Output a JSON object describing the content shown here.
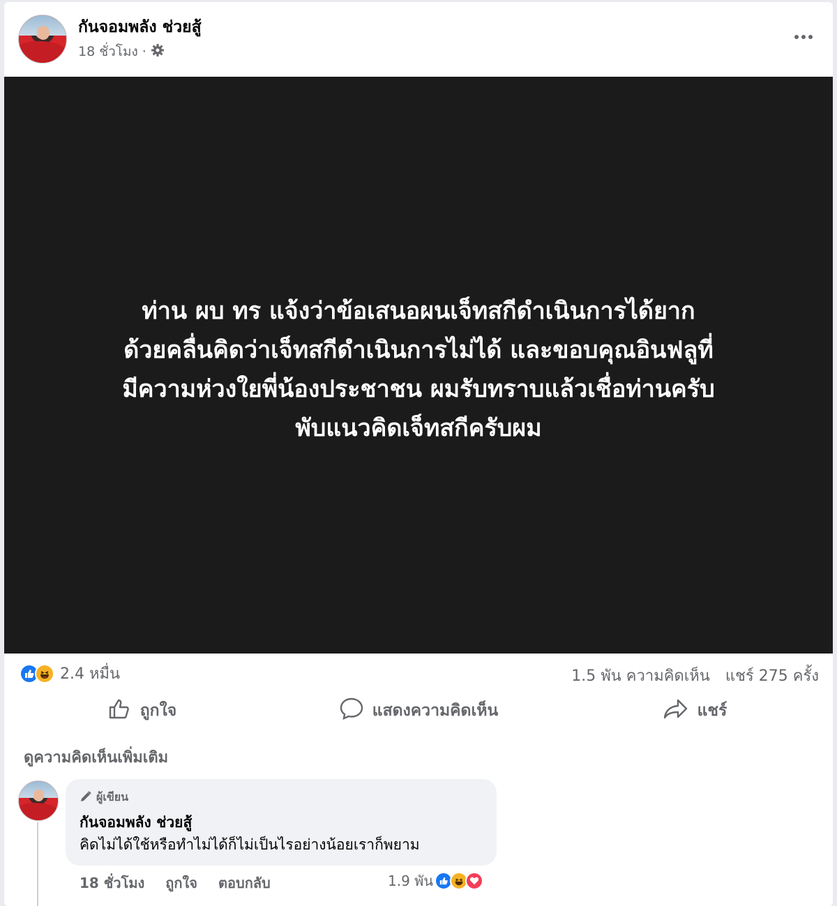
{
  "post": {
    "author": "กันจอมพลัง ช่วยสู้",
    "time": "18 ชั่วโมง",
    "separator": "·",
    "privacy_icon": "gear-icon",
    "more_icon": "more-horizontal-icon",
    "text_lines": [
      "ท่าน ผบ ทร แจ้งว่าข้อเสนอผนเจ็ทสกีดำเนินการได้ยาก",
      "ด้วยคลื่นคิดว่าเจ็ทสกีดำเนินการไม่ได้ และขอบคุณอินฟลูที่",
      "มีความห่วงใยพี่น้องประชาชน ผมรับทราบแล้วเชื่อท่านครับ",
      "พับแนวคิดเจ็ทสกีครับผม"
    ]
  },
  "stats": {
    "reactions_count": "2.4 หมื่น",
    "comments": "1.5 พัน ความคิดเห็น",
    "shares": "แชร์ 275 ครั้ง"
  },
  "actions": {
    "like": "ถูกใจ",
    "comment": "แสดงความคิดเห็น",
    "share": "แชร์"
  },
  "more_comments": "ดูความคิดเห็นเพิ่มเติม",
  "comment": {
    "badge": "ผู้เขียน",
    "author": "กันจอมพลัง ช่วยสู้",
    "text": "คิดไม่ได้ใช้หรือทำไม่ได้ก็ไม่เป็นไรอย่างน้อยเราก็พยาม",
    "time": "18 ชั่วโมง",
    "like": "ถูกใจ",
    "reply": "ตอบกลับ",
    "reactions_count": "1.9 พัน"
  },
  "colors": {
    "like_blue": "#1877f2",
    "haha_yellow": "#f7b125",
    "love_red": "#f33e58",
    "image_bg": "#1b1b1b"
  }
}
